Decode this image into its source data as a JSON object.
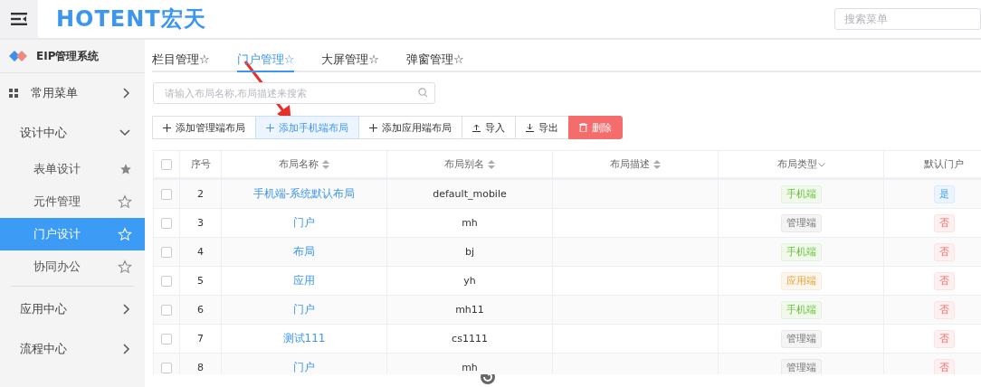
{
  "header": {
    "logo": "HOTENT宏天",
    "search": {
      "placeholder": "搜索菜单"
    }
  },
  "sidebar": {
    "system": "EIP管理系统",
    "items": [
      {
        "kind": "group",
        "label": "常用菜单",
        "expanded": false
      },
      {
        "kind": "group",
        "label": "设计中心",
        "expanded": true,
        "children": [
          {
            "label": "表单设计",
            "favorite": true,
            "selected": false
          },
          {
            "label": "元件管理",
            "favorite": false,
            "selected": false
          },
          {
            "label": "门户设计",
            "favorite": false,
            "selected": true
          },
          {
            "label": "协同办公",
            "favorite": false,
            "selected": false
          }
        ]
      },
      {
        "kind": "group",
        "label": "应用中心",
        "expanded": false
      },
      {
        "kind": "group",
        "label": "流程中心",
        "expanded": false
      }
    ]
  },
  "tabs": [
    {
      "label": "栏目管理☆",
      "selected": false
    },
    {
      "label": "门户管理☆",
      "selected": true
    },
    {
      "label": "大屏管理☆",
      "selected": false
    },
    {
      "label": "弹窗管理☆",
      "selected": false
    }
  ],
  "search": {
    "placeholder": "请输入布局名称,布局描述来搜索"
  },
  "toolbar": [
    {
      "kind": "add",
      "label": "添加管理端布局",
      "selected": false
    },
    {
      "kind": "add",
      "label": "添加手机端布局",
      "selected": true
    },
    {
      "kind": "add",
      "label": "添加应用端布局",
      "selected": false
    },
    {
      "kind": "import",
      "label": "导入",
      "selected": false
    },
    {
      "kind": "export",
      "label": "导出",
      "selected": false
    },
    {
      "kind": "delete",
      "label": "删除"
    }
  ],
  "table": {
    "all_checked": false,
    "columns": [
      {
        "label": "序号",
        "sortable": false
      },
      {
        "label": "布局名称",
        "sortable": true
      },
      {
        "label": "布局别名",
        "sortable": true
      },
      {
        "label": "布局描述",
        "sortable": true
      },
      {
        "label": "布局类型",
        "sortable": false
      },
      {
        "label": "默认门户",
        "sortable": false
      }
    ],
    "rows": [
      {
        "index": "2",
        "name": "手机端-系统默认布局",
        "alias": "default_mobile",
        "type": {
          "kind": "mobile",
          "label": "手机端"
        },
        "default": {
          "value": true,
          "label": "是"
        },
        "checked": false
      },
      {
        "index": "3",
        "name": "门户",
        "alias": "mh",
        "type": {
          "kind": "admin",
          "label": "管理端"
        },
        "default": {
          "value": false,
          "label": "否"
        },
        "checked": false
      },
      {
        "index": "4",
        "name": "布局",
        "alias": "bj",
        "type": {
          "kind": "mobile",
          "label": "手机端"
        },
        "default": {
          "value": false,
          "label": "否"
        },
        "checked": false
      },
      {
        "index": "5",
        "name": "应用",
        "alias": "yh",
        "type": {
          "kind": "app",
          "label": "应用端"
        },
        "default": {
          "value": false,
          "label": "否"
        },
        "checked": false
      },
      {
        "index": "6",
        "name": "门户",
        "alias": "mh11",
        "type": {
          "kind": "mobile",
          "label": "手机端"
        },
        "default": {
          "value": false,
          "label": "否"
        },
        "checked": false
      },
      {
        "index": "7",
        "name": "测试111",
        "alias": "cs1111",
        "type": {
          "kind": "admin",
          "label": "管理端"
        },
        "default": {
          "value": false,
          "label": "否"
        },
        "checked": false
      },
      {
        "index": "8",
        "name": "门户",
        "alias": "mh",
        "type": {
          "kind": "admin",
          "label": "管理端"
        },
        "default": {
          "value": false,
          "label": "否"
        },
        "checked": false
      }
    ]
  }
}
